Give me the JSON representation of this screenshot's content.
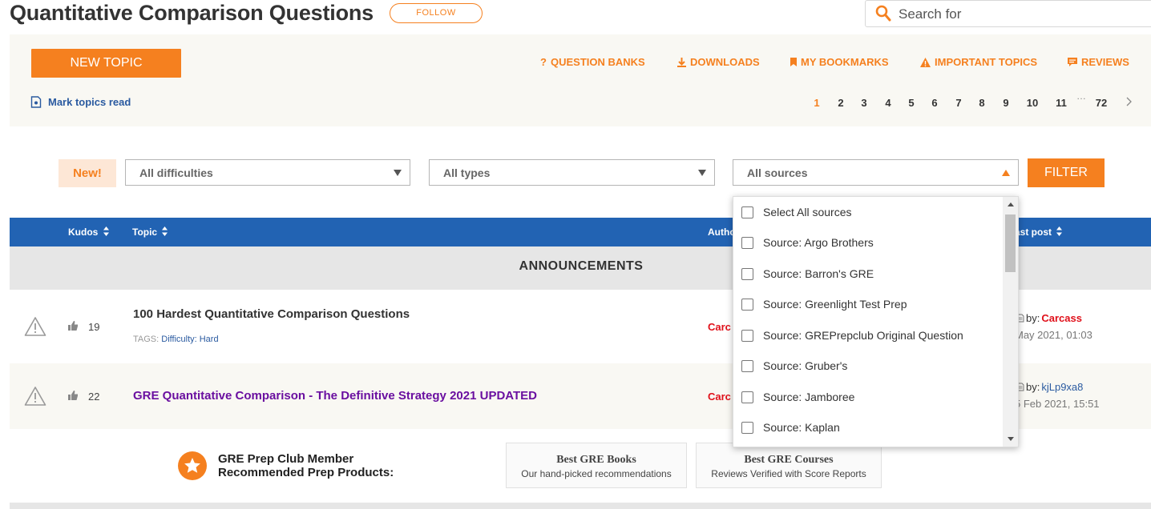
{
  "header": {
    "title": "Quantitative Comparison Questions",
    "follow_label": "FOLLOW",
    "search_placeholder": "Search for"
  },
  "toolbar": {
    "new_topic_label": "NEW TOPIC",
    "links": [
      {
        "label": "QUESTION BANKS",
        "icon": "question-icon"
      },
      {
        "label": "DOWNLOADS",
        "icon": "download-icon"
      },
      {
        "label": "MY BOOKMARKS",
        "icon": "bookmark-icon"
      },
      {
        "label": "IMPORTANT TOPICS",
        "icon": "warning-icon"
      },
      {
        "label": "REVIEWS",
        "icon": "chat-icon"
      }
    ],
    "mark_read_label": "Mark topics read",
    "pagination": {
      "pages": [
        "1",
        "2",
        "3",
        "4",
        "5",
        "6",
        "7",
        "8",
        "9",
        "10",
        "11",
        "72"
      ],
      "ellipsis": "…",
      "current": "1"
    }
  },
  "filters": {
    "new_badge": "New!",
    "difficulty": "All difficulties",
    "types": "All types",
    "sources": "All sources",
    "filter_label": "FILTER",
    "sources_options": [
      "Select All sources",
      "Source: Argo Brothers",
      "Source: Barron's GRE",
      "Source: Greenlight Test Prep",
      "Source: GREPrepclub Original Question",
      "Source: Gruber's",
      "Source: Jamboree",
      "Source: Kaplan"
    ]
  },
  "table": {
    "headers": {
      "kudos": "Kudos",
      "topic": "Topic",
      "author": "Autho",
      "last_post": "ast post"
    },
    "announcements_label": "ANNOUNCEMENTS",
    "rows": [
      {
        "kudos": "19",
        "title": "100 Hardest Quantitative Comparison Questions",
        "title_color": "#333333",
        "tags_label": "TAGS:",
        "tags": "Difficulty: Hard",
        "author": "Carc",
        "last_by_label": "by:",
        "last_by": "Carcass",
        "last_by_color": "#e0101a",
        "last_date": "May 2021, 01:03"
      },
      {
        "kudos": "22",
        "title": "GRE Quantitative Comparison - The Definitive Strategy 2021 UPDATED",
        "title_color": "#6a0fa0",
        "author": "Carc",
        "last_by_label": "by:",
        "last_by": "kjLp9xa8",
        "last_by_color": "#2a5aa0",
        "last_date": "5 Feb 2021, 15:51"
      }
    ]
  },
  "promo": {
    "line1": "GRE Prep Club Member",
    "line2": "Recommended Prep Products:",
    "cards": [
      {
        "title": "Best GRE Books",
        "subtitle": "Our hand-picked recommendations"
      },
      {
        "title": "Best GRE Courses",
        "subtitle": "Reviews Verified with Score Reports"
      }
    ]
  },
  "colors": {
    "accent": "#f5801f",
    "table_header": "#2263b3",
    "link": "#2a5aa0",
    "author_red": "#e0101a"
  }
}
